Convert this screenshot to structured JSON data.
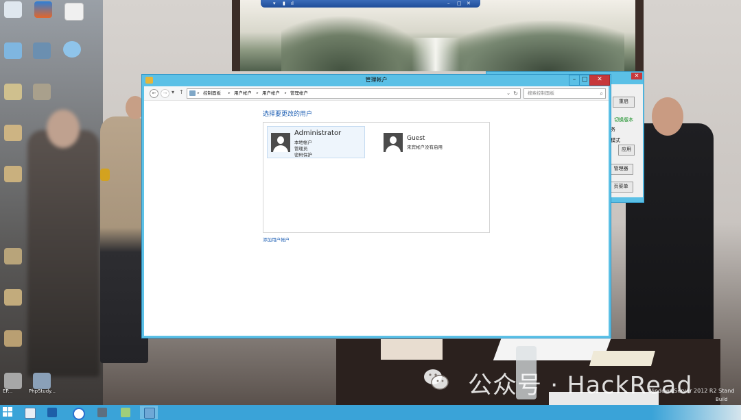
{
  "window": {
    "title": "管理帐户",
    "minimize_glyph": "–",
    "maximize_glyph": "□",
    "close_glyph": "✕"
  },
  "nav": {
    "back_glyph": "←",
    "forward_glyph": "→",
    "dropdown_glyph": "▾",
    "up_glyph": "↑",
    "breadcrumbs": [
      "控制面板",
      "用户帐户",
      "用户帐户",
      "管理帐户"
    ],
    "separator_glyph": "▸",
    "address_dropdown_glyph": "⌄",
    "refresh_glyph": "↻"
  },
  "search": {
    "placeholder": "搜索控制面板",
    "icon_glyph": "⌕"
  },
  "main": {
    "heading": "选择要更改的用户",
    "users": [
      {
        "name": "Administrator",
        "lines": [
          "本地帐户",
          "管理员",
          "密码保护"
        ],
        "selected": true
      },
      {
        "name": "Guest",
        "lines": [
          "来宾帐户没有启用"
        ],
        "selected": false
      }
    ],
    "add_user_link": "添加用户帐户"
  },
  "background_window": {
    "close_glyph": "✕",
    "restart_button": "重启",
    "switch_text": "切换版本",
    "service_text": "务",
    "mode_text": "模式",
    "apply_button": "应用",
    "manager_button": "管理器",
    "menu_button": "页菜单"
  },
  "desktop": {
    "icon_labels": [
      "EP...",
      "PhpStudy..."
    ],
    "watermark": "公众号 · HackRead",
    "os_version": "Windows Server 2012 R2 Stand",
    "build_text": "Build"
  },
  "colors": {
    "window_frame": "#5bc0e6",
    "close_red": "#c7383b",
    "link_blue": "#1e5fb4",
    "taskbar": "#3aa3d8"
  },
  "icons": {
    "app": "control-panel-icon",
    "user": "user-avatar-icon",
    "start": "windows-logo-icon"
  }
}
